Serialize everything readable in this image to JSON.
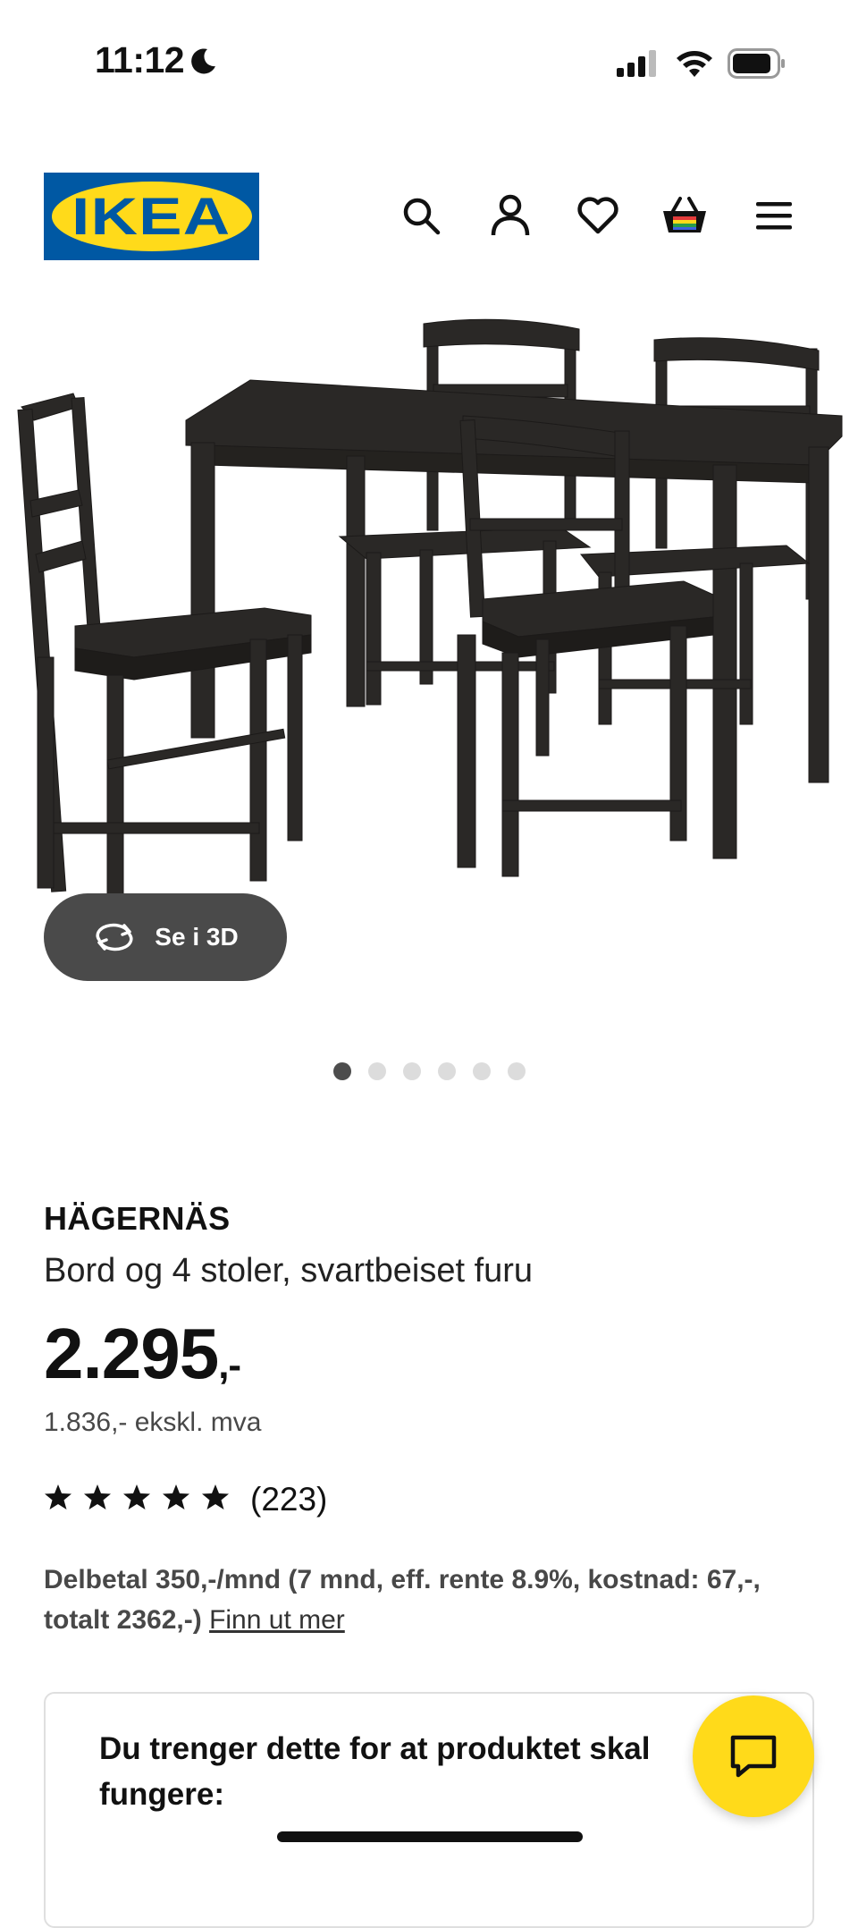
{
  "status_bar": {
    "time": "11:12"
  },
  "header": {
    "logo_text": "IKEA",
    "icons": [
      "search-icon",
      "account-icon",
      "heart-icon",
      "cart-icon",
      "menu-icon"
    ]
  },
  "gallery": {
    "view_3d_label": "Se i 3D",
    "image_count": 6,
    "active_index": 0
  },
  "product": {
    "name": "HÄGERNÄS",
    "description": "Bord og 4 stoler, svartbeiset furu",
    "price": "2.295",
    "price_suffix": ",-",
    "price_ex_vat": "1.836,- ekskl. mva",
    "rating": 5,
    "rating_count": "(223)"
  },
  "financing": {
    "text": "Delbetal 350,-/mnd (7 mnd, eff. rente 8.9%, kostnad: 67,-, totalt 2362,-)",
    "link": "Finn ut mer"
  },
  "required_card": {
    "title": "Du trenger dette for at produktet skal fungere:"
  },
  "colors": {
    "ikea_blue": "#0058a3",
    "ikea_yellow": "#ffda1a",
    "text_dark": "#111111",
    "text_muted": "#484848"
  }
}
